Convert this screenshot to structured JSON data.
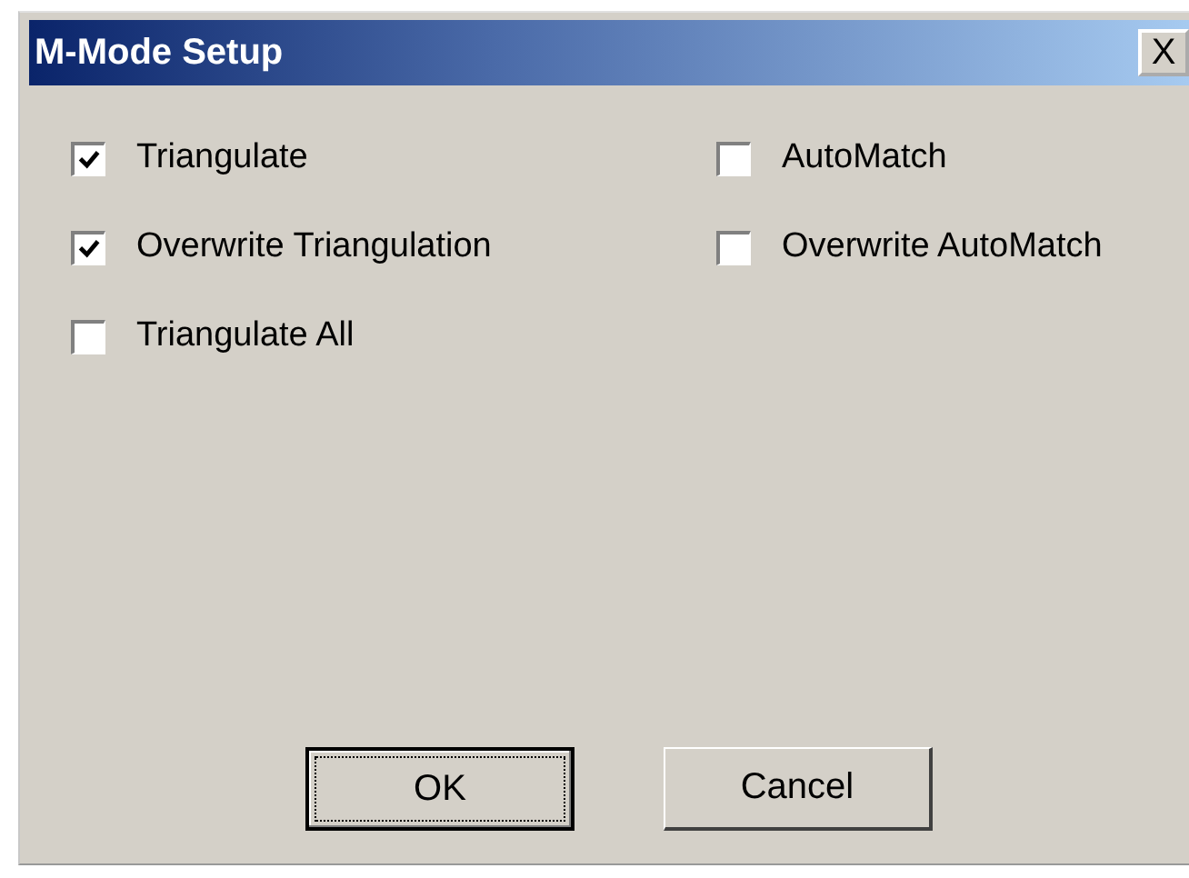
{
  "window": {
    "title": "M-Mode Setup",
    "close": "X"
  },
  "columns": [
    [
      {
        "label": "Triangulate",
        "checked": true
      },
      {
        "label": "Overwrite Triangulation",
        "checked": true
      },
      {
        "label": "Triangulate All",
        "checked": false
      }
    ],
    [
      {
        "label": "AutoMatch",
        "checked": false
      },
      {
        "label": "Overwrite AutoMatch",
        "checked": false
      }
    ]
  ],
  "buttons": [
    {
      "label": "OK",
      "default": true
    },
    {
      "label": "Cancel",
      "default": false
    }
  ]
}
